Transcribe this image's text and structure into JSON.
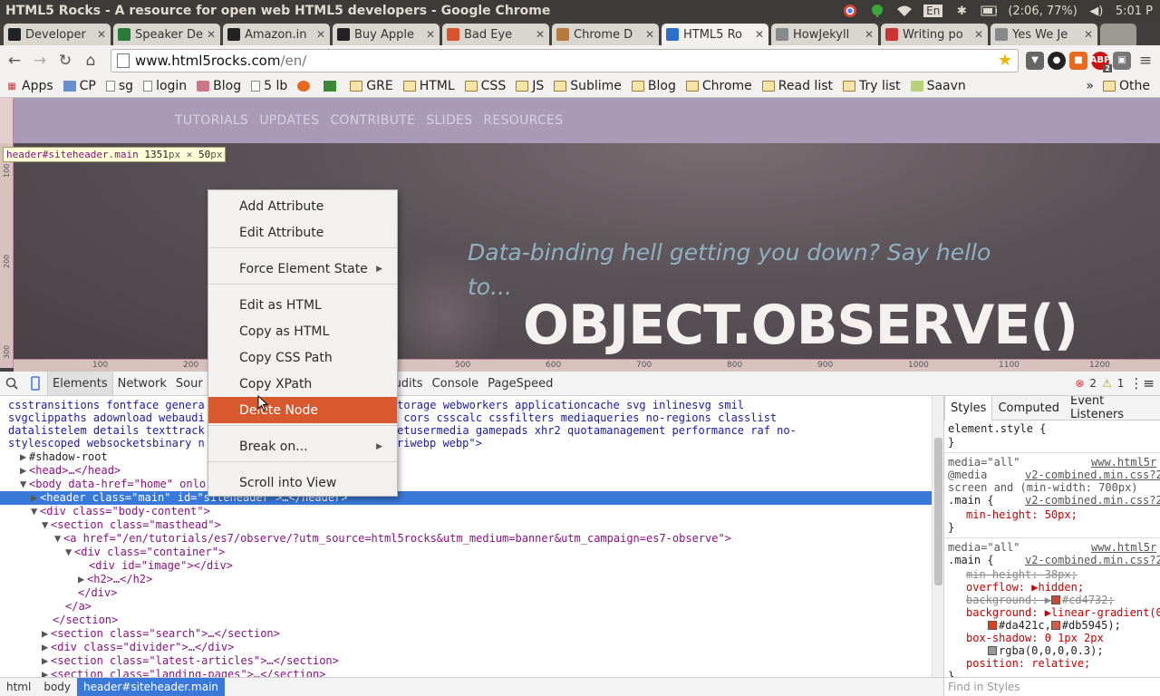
{
  "window": {
    "title": "HTML5 Rocks - A resource for open web HTML5 developers - Google Chrome",
    "tray": {
      "lang": "En",
      "battery": "(2:06, 77%)",
      "clock": "5:01 P"
    }
  },
  "tabs": [
    {
      "label": "Developer",
      "icon_color": "#222",
      "icon": "github-icon"
    },
    {
      "label": "Speaker De",
      "icon_color": "#2a7a3a",
      "icon": "speakerdeck-icon"
    },
    {
      "label": "Amazon.in",
      "icon_color": "#222",
      "icon": "amazon-icon"
    },
    {
      "label": "Buy Apple",
      "icon_color": "#222",
      "icon": "amazon-icon"
    },
    {
      "label": "Bad Eye",
      "icon_color": "#d9532c",
      "icon": "goodreads-icon"
    },
    {
      "label": "Chrome D",
      "icon_color": "#b87a3a",
      "icon": "chrome-dev-icon"
    },
    {
      "label": "HTML5 Ro",
      "icon_color": "#2a6fc9",
      "icon": "html5-icon",
      "active": true
    },
    {
      "label": "HowJekyll",
      "icon_color": "#888",
      "icon": "page-icon"
    },
    {
      "label": "Writing po",
      "icon_color": "#c33",
      "icon": "pen-icon"
    },
    {
      "label": "Yes We Je",
      "icon_color": "#888",
      "icon": "page-icon"
    }
  ],
  "toolbar": {
    "url_host": "www.html5rocks.com",
    "url_path": "/en/",
    "ext_badge": "2"
  },
  "bookmarks": [
    {
      "label": "Apps",
      "icon": "apps-icon"
    },
    {
      "label": "CP",
      "icon": "cp-icon"
    },
    {
      "label": "sg",
      "icon": "page-icon"
    },
    {
      "label": "login",
      "icon": "page-icon"
    },
    {
      "label": "Blog",
      "icon": "blog-icon"
    },
    {
      "label": "5 lb",
      "icon": "page-icon"
    },
    {
      "label": "",
      "icon": "firefox-icon"
    },
    {
      "label": "",
      "icon": "android-icon"
    },
    {
      "label": "GRE",
      "icon": "folder-icon"
    },
    {
      "label": "HTML",
      "icon": "folder-icon"
    },
    {
      "label": "CSS",
      "icon": "folder-icon"
    },
    {
      "label": "JS",
      "icon": "folder-icon"
    },
    {
      "label": "Sublime",
      "icon": "folder-icon"
    },
    {
      "label": "Blog",
      "icon": "folder-icon"
    },
    {
      "label": "Chrome",
      "icon": "folder-icon"
    },
    {
      "label": "Read list",
      "icon": "folder-icon"
    },
    {
      "label": "Try list",
      "icon": "folder-icon"
    },
    {
      "label": "Saavn",
      "icon": "saavn-icon"
    }
  ],
  "bookmarks_overflow": "»",
  "other_bookmarks": "Othe",
  "site": {
    "nav": [
      "TUTORIALS",
      "UPDATES",
      "CONTRIBUTE",
      "SLIDES",
      "RESOURCES"
    ],
    "tagline": "Data-binding hell getting you down? Say hello to...",
    "headline": "OBJECT.OBSERVE()"
  },
  "inspect_tooltip": {
    "selector": "header#siteheader.main",
    "width": "1351",
    "height": "50",
    "unit": "px",
    "times": "×"
  },
  "rulers": {
    "vertical": [
      "100",
      "200",
      "300"
    ],
    "horizontal": [
      "100",
      "200",
      "500",
      "600",
      "700",
      "800",
      "900",
      "1000",
      "1100",
      "1200"
    ]
  },
  "devtools": {
    "tabs": [
      "Elements",
      "Network",
      "Sour",
      "s",
      "Audits",
      "Console",
      "PageSpeed"
    ],
    "errors": "2",
    "warnings": "1",
    "styles_tabs": [
      "Styles",
      "Computed",
      "Event Listeners"
    ],
    "find_placeholder": "Find in Styles",
    "breadcrumbs": [
      "html",
      "body",
      "header#siteheader.main"
    ]
  },
  "dom_lines": [
    {
      "text": "csstransitions fontface genera",
      "tail": "torage sessionstorage webworkers applicationcache svg inlinesvg smil"
    },
    {
      "text": "svgclippaths adownload webaudi",
      "tail": "contenteditable cors csscalc cssfilters mediaqueries no-regions classlist"
    },
    {
      "text": "datalistelem details texttrack",
      "tail": "em fullscreen getusermedia gamepads xhr2 quotamanagement performance raf no-"
    },
    {
      "text": "stylescoped websocketsbinary n",
      "tail": "datauriwebp webp\">"
    }
  ],
  "dom_tree": {
    "shadow": "#shadow-root",
    "head": "<head>…</head>",
    "body_open": "<body data-href=\"home\" onlo",
    "header_line": "<header class=\"main\" id=\"siteheader\">…</header>",
    "div_body": "<div class=\"body-content\">",
    "section_masthead": "<section class=\"masthead\">",
    "a_href": "<a href=\"/en/tutorials/es7/observe/?utm_source=html5rocks&utm_medium=banner&utm_campaign=es7-observe\">",
    "div_container": "<div class=\"container\">",
    "div_image": "<div id=\"image\"></div>",
    "h2": "<h2>…</h2>",
    "div_close": "</div>",
    "a_close": "</a>",
    "section_close": "</section>",
    "section_search": "<section class=\"search\">…</section>",
    "div_divider": "<div class=\"divider\">…</div>",
    "section_latest": "<section class=\"latest-articles\">…</section>",
    "section_landing": "<section class=\"landing-pages\">…</section>"
  },
  "styles": {
    "element_style": "element.style {",
    "close": "}",
    "media_all": "media=\"all\"",
    "source1": "www.html5r",
    "media_rule": "@media",
    "source_file": "v2-combined.min.css?2",
    "media_cond1": "screen and (min-width: 700px)",
    "selector": ".main {",
    "minheight": "min-height: 50px;",
    "minheight_old": "min-height: 38px;",
    "overflow": "overflow: ▶hidden;",
    "background_old": "background: ▶",
    "background_old_val": "#cd4732;",
    "background": "background: ▶linear-gradient(0",
    "grad1": "#da421c,",
    "grad2": "#db5945);",
    "boxshadow": "box-shadow: 0 1px 2px",
    "boxshadow_val": "rgba(0,0,0,0.3);",
    "position": "position: relative;"
  },
  "context_menu": [
    {
      "label": "Add Attribute"
    },
    {
      "label": "Edit Attribute"
    },
    {
      "label": "Force Element State",
      "submenu": true
    },
    {
      "label": "Edit as HTML"
    },
    {
      "label": "Copy as HTML"
    },
    {
      "label": "Copy CSS Path"
    },
    {
      "label": "Copy XPath"
    },
    {
      "label": "Delete Node",
      "highlighted": true
    },
    {
      "label": "Break on...",
      "submenu": true
    },
    {
      "label": "Scroll into View"
    }
  ],
  "colors": {
    "menu_highlight": "#d8592e",
    "selection": "#3879d9",
    "swatch_red": "#cd4732"
  }
}
